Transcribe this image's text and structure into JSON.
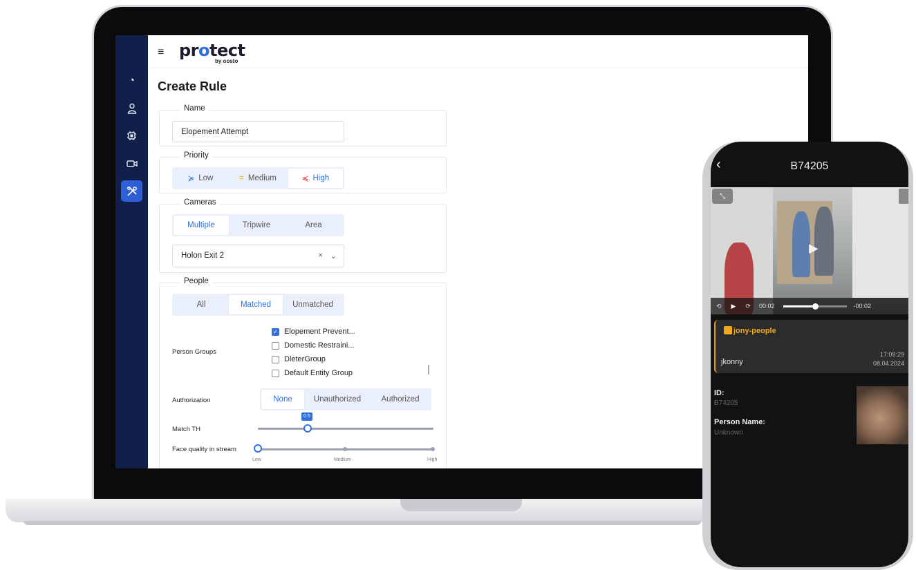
{
  "app": {
    "logo": {
      "pre": "pr",
      "o": "o",
      "post": "tect",
      "sub": "by oosto"
    },
    "page_title": "Create Rule"
  },
  "sidebar": {
    "icons": [
      "dashboard-pie-icon",
      "person-icon",
      "chip-icon",
      "camera-icon",
      "tools-icon"
    ]
  },
  "form": {
    "name": {
      "legend": "Name",
      "value": "Elopement Attempt"
    },
    "priority": {
      "legend": "Priority",
      "options": [
        "Low",
        "Medium",
        "High"
      ],
      "selected": "High",
      "colors": {
        "low": "#2f6fe0",
        "medium": "#f0b400",
        "high": "#e02d2d"
      }
    },
    "cameras": {
      "legend": "Cameras",
      "options": [
        "Multiple",
        "Tripwire",
        "Area"
      ],
      "selected": "Multiple",
      "camera_value": "Holon Exit 2"
    },
    "people": {
      "legend": "People",
      "options": [
        "All",
        "Matched",
        "Unmatched"
      ],
      "selected": "Matched",
      "person_groups_label": "Person Groups",
      "groups": [
        {
          "label": "Elopement Prevent...",
          "checked": true
        },
        {
          "label": "Domestic Restraini...",
          "checked": false
        },
        {
          "label": "DleterGroup",
          "checked": false
        },
        {
          "label": "Default Entity Group",
          "checked": false
        }
      ],
      "authorization_label": "Authorization",
      "authorization_options": [
        "None",
        "Unauthorized",
        "Authorized"
      ],
      "authorization_selected": "None",
      "match_th_label": "Match TH",
      "match_th_value": "0.5",
      "face_quality_label": "Face quality in stream",
      "face_quality_ticks": [
        "Low",
        "Medium",
        "High"
      ],
      "face_quality_value": "Low"
    }
  },
  "phone": {
    "title": "B74205",
    "video": {
      "elapsed": "00:02",
      "remaining": "-00:02",
      "progress": 0.5
    },
    "alert": {
      "tag": "jony-people",
      "name": "jkonny",
      "time": "17:09:29",
      "date": "08.04.2024"
    },
    "details": {
      "id_label": "ID:",
      "id_value": "B74205",
      "person_label": "Person Name:",
      "person_value": "Unknown"
    }
  }
}
